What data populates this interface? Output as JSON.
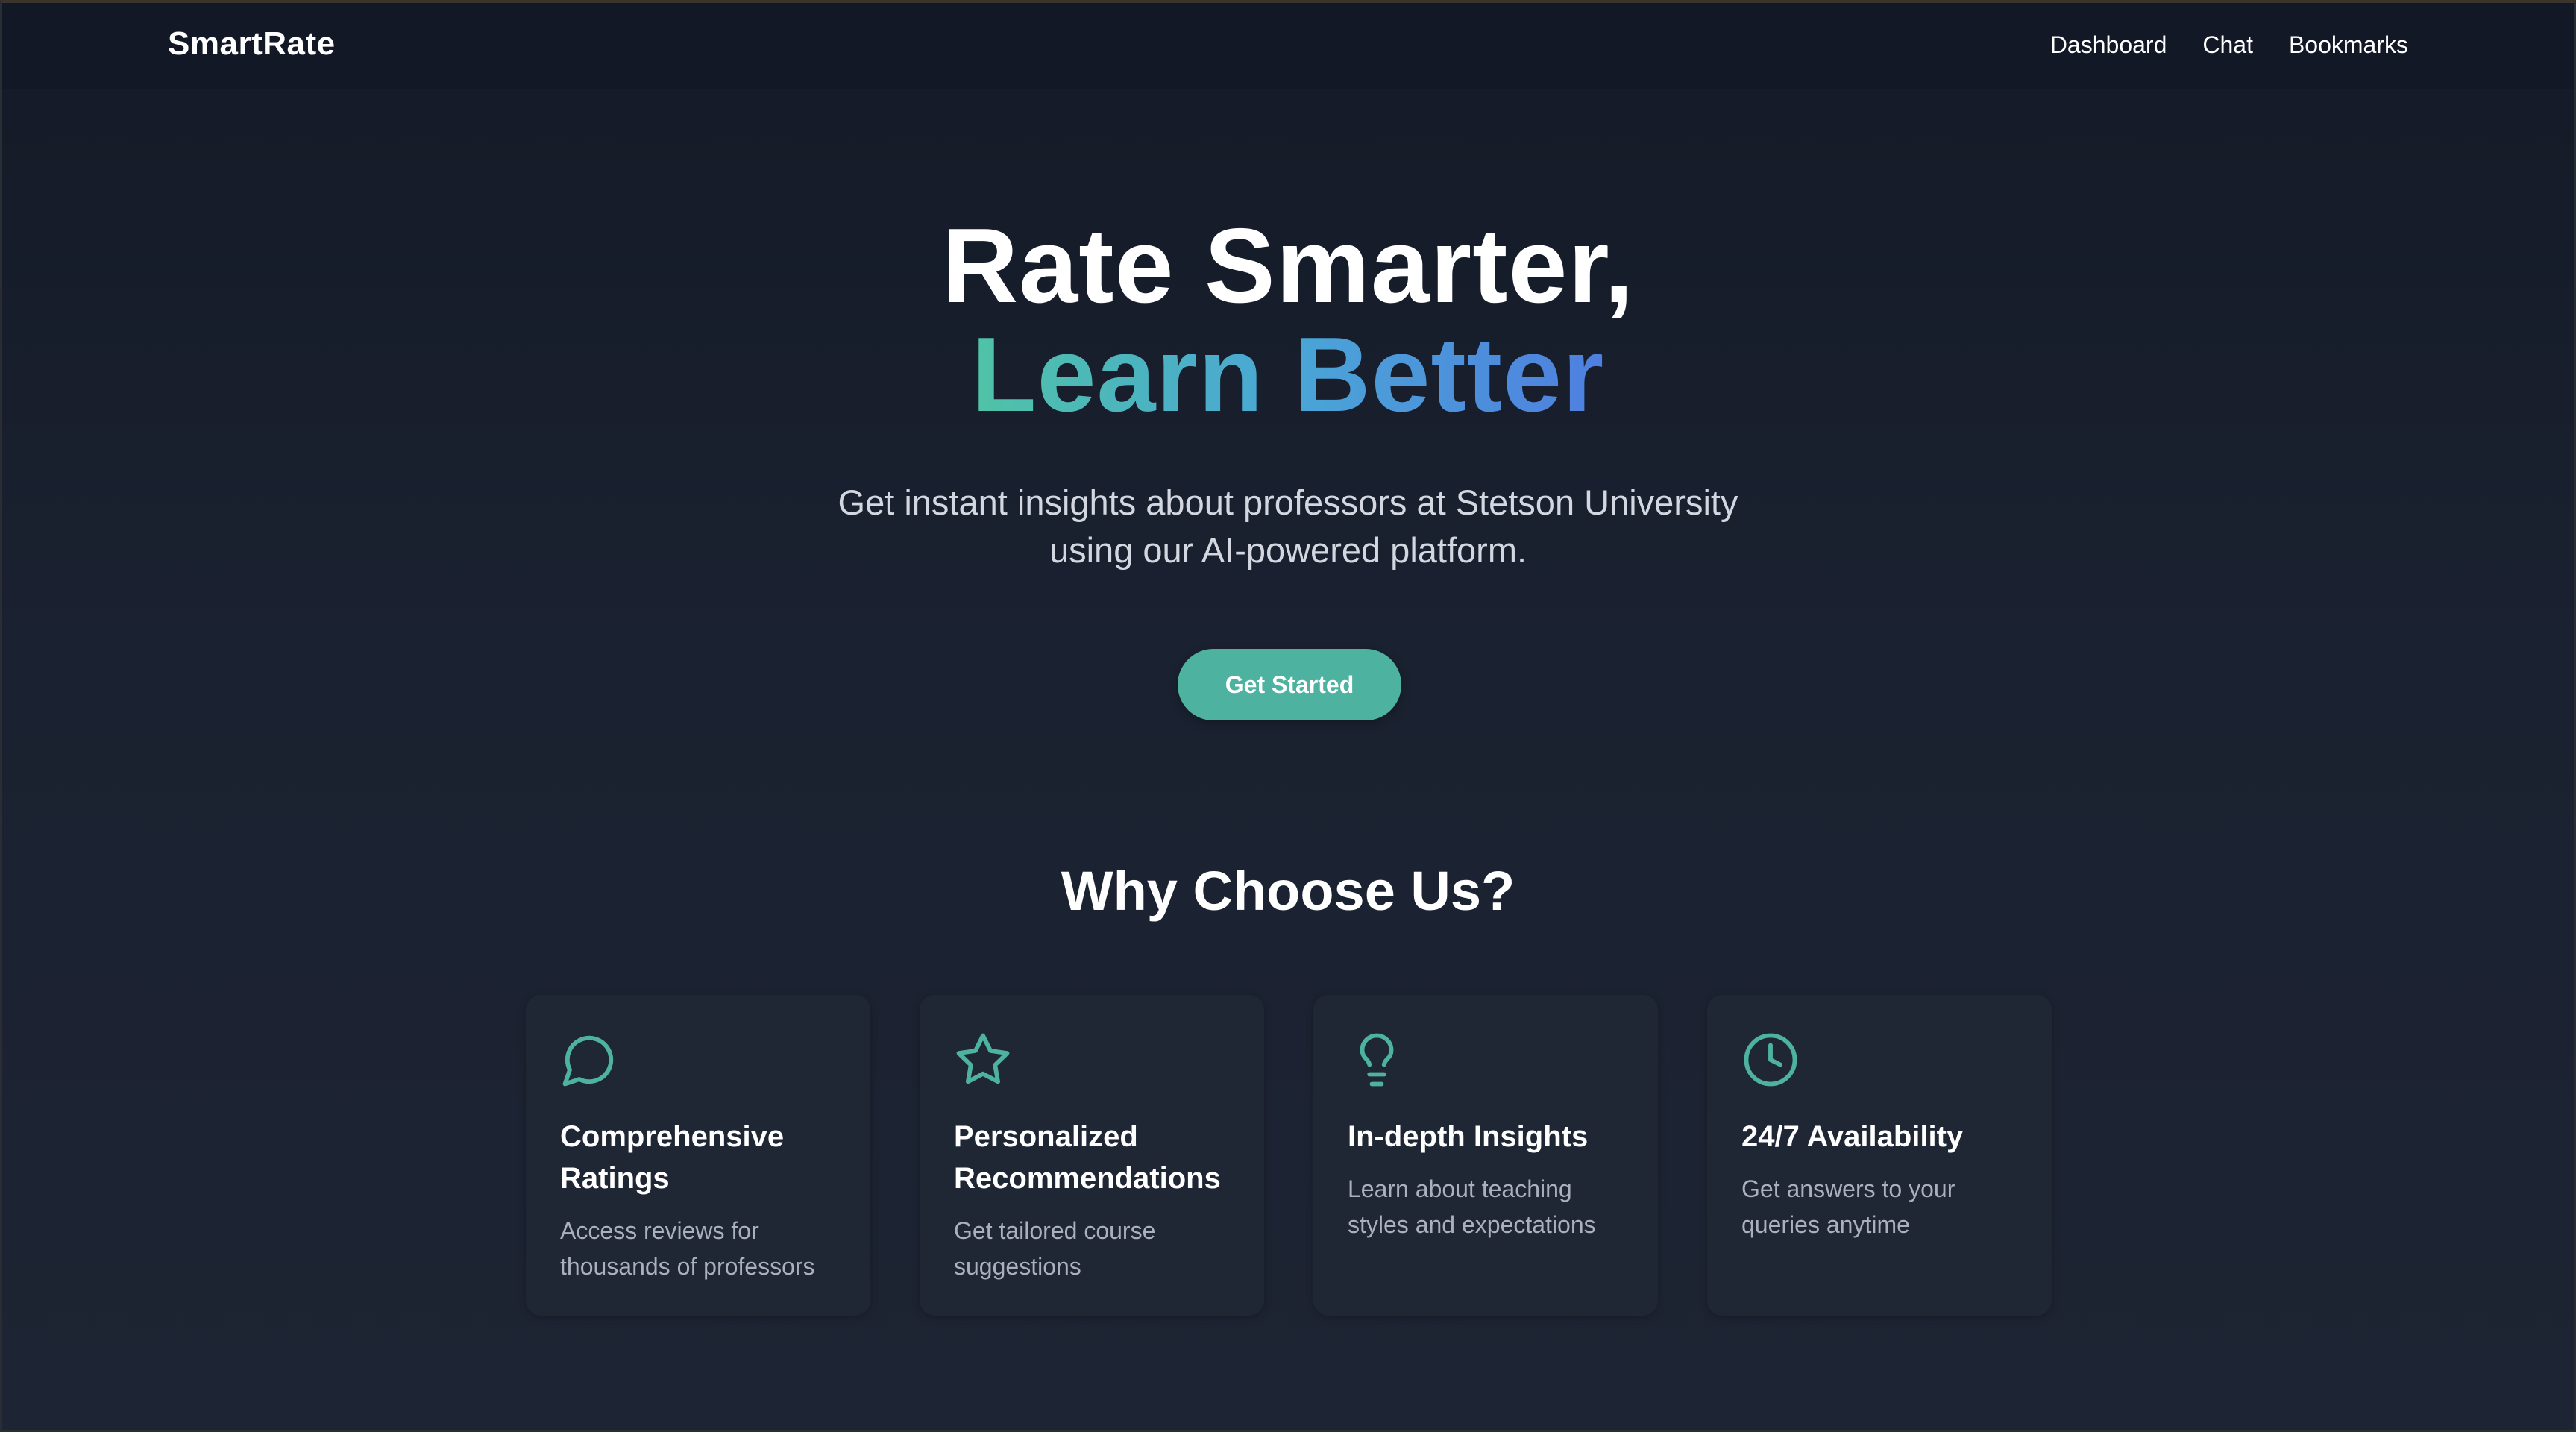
{
  "nav": {
    "brand": "SmartRate",
    "links": [
      "Dashboard",
      "Chat",
      "Bookmarks"
    ]
  },
  "hero": {
    "title_line1": "Rate Smarter,",
    "title_line2": "Learn Better",
    "subtitle_line1": "Get instant insights about professors at Stetson University",
    "subtitle_line2": "using our AI-powered platform.",
    "cta_label": "Get Started"
  },
  "features": {
    "heading": "Why Choose Us?",
    "cards": [
      {
        "icon": "chat-bubble-icon",
        "title_line1": "Comprehensive",
        "title_line2": "Ratings",
        "desc_line1": "Access reviews for",
        "desc_line2": "thousands of professors"
      },
      {
        "icon": "star-icon",
        "title_line1": "Personalized",
        "title_line2": "Recommendations",
        "desc_line1": "Get tailored course",
        "desc_line2": "suggestions"
      },
      {
        "icon": "lightbulb-icon",
        "title_line1": "In-depth Insights",
        "title_line2": "",
        "desc_line1": "Learn about teaching",
        "desc_line2": "styles and expectations"
      },
      {
        "icon": "clock-icon",
        "title_line1": "24/7 Availability",
        "title_line2": "",
        "desc_line1": "Get answers to your",
        "desc_line2": "queries anytime"
      }
    ]
  },
  "colors": {
    "accent": "#4db3a0",
    "gradient_start": "#4fc3a6",
    "gradient_end": "#4f7fe0",
    "background": "#1a2130",
    "card": "#1f2634"
  }
}
